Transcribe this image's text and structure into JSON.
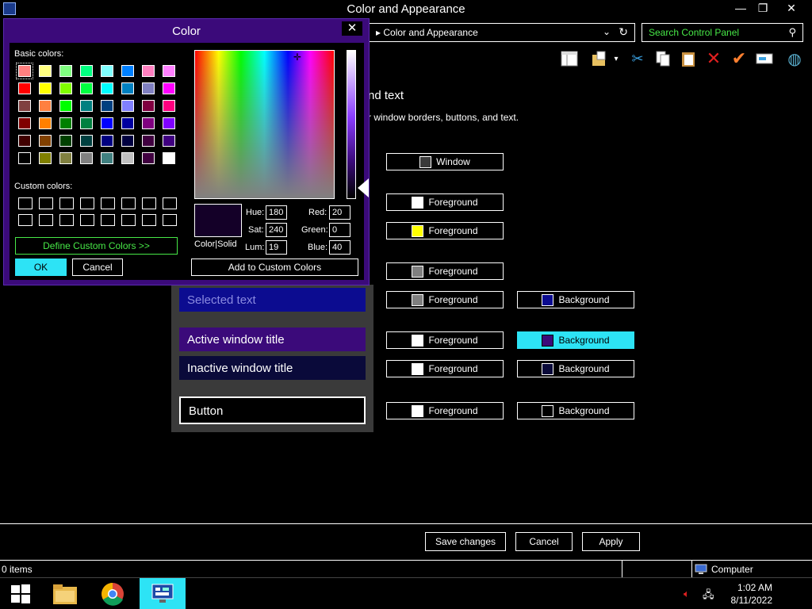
{
  "window": {
    "title": "Color and Appearance",
    "buttons": {
      "minimize": "—",
      "restore": "❐",
      "close": "✕"
    }
  },
  "address": {
    "breadcrumb": "Color and Appearance"
  },
  "search": {
    "placeholder": "Search Control Panel"
  },
  "content": {
    "heading": "nd text",
    "subheading": "r window borders, buttons, and text."
  },
  "preview": {
    "selected_text": "Selected text",
    "active_title": "Active window title",
    "inactive_title": "Inactive window title",
    "button": "Button"
  },
  "elements": {
    "window_label": "Window",
    "fg1_label": "Foreground",
    "fg2_label": "Foreground",
    "fg3_label": "Foreground",
    "sel_fg_label": "Foreground",
    "sel_bg_label": "Background",
    "active_fg_label": "Foreground",
    "active_bg_label": "Background",
    "inactive_fg_label": "Foreground",
    "inactive_bg_label": "Background",
    "button_fg_label": "Foreground",
    "button_bg_label": "Background"
  },
  "actions": {
    "save": "Save changes",
    "cancel": "Cancel",
    "apply": "Apply"
  },
  "status": {
    "items": "0 items",
    "location": "Computer"
  },
  "taskbar": {
    "time": "1:02 AM",
    "date": "8/11/2022"
  },
  "dialog": {
    "title": "Color",
    "close": "✕",
    "basic_label": "Basic colors:",
    "custom_label": "Custom colors:",
    "define_label": "Define Custom Colors >>",
    "ok_label": "OK",
    "cancel_label": "Cancel",
    "add_label": "Add to Custom Colors",
    "solid_label": "Color|Solid",
    "hue_label": "Hue:",
    "hue": "180",
    "sat_label": "Sat:",
    "sat": "240",
    "lum_label": "Lum:",
    "lum": "19",
    "red_label": "Red:",
    "red": "20",
    "green_label": "Green:",
    "green": "0",
    "blue_label": "Blue:",
    "blue": "40"
  },
  "colors": {
    "accent": "#2de3f5",
    "green_text": "#47e847",
    "dialog_frame": "#3b0a7a",
    "active_title_bg": "#3b0a7a",
    "inactive_title_bg": "#0a0a3a",
    "selected_bg": "#0c0c90"
  },
  "basic_colors": [
    "#ff8080",
    "#ffff80",
    "#80ff80",
    "#00ff80",
    "#80ffff",
    "#0080ff",
    "#ff80c0",
    "#ff80ff",
    "#ff0000",
    "#ffff00",
    "#80ff00",
    "#00ff40",
    "#00ffff",
    "#0080c0",
    "#8080c0",
    "#ff00ff",
    "#804040",
    "#ff8040",
    "#00ff00",
    "#008080",
    "#004080",
    "#8080ff",
    "#800040",
    "#ff0080",
    "#800000",
    "#ff8000",
    "#008000",
    "#008040",
    "#0000ff",
    "#0000a0",
    "#800080",
    "#8000ff",
    "#400000",
    "#804000",
    "#004000",
    "#004040",
    "#000080",
    "#000040",
    "#400040",
    "#400080",
    "#000000",
    "#808000",
    "#808040",
    "#808080",
    "#408080",
    "#c0c0c0",
    "#400040",
    "#ffffff"
  ]
}
